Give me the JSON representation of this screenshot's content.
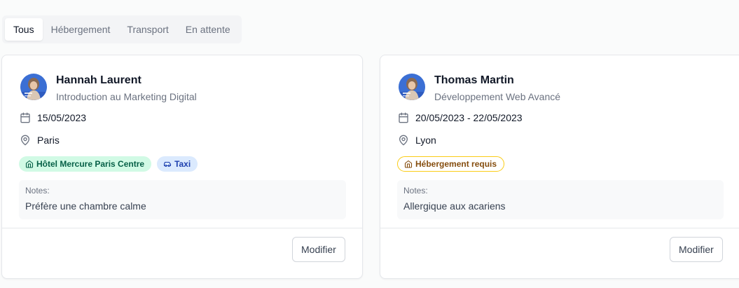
{
  "tabs": [
    {
      "label": "Tous",
      "active": true
    },
    {
      "label": "Hébergement",
      "active": false
    },
    {
      "label": "Transport",
      "active": false
    },
    {
      "label": "En attente",
      "active": false
    }
  ],
  "cards": [
    {
      "name": "Hannah Laurent",
      "course": "Introduction au Marketing Digital",
      "date": "15/05/2023",
      "location": "Paris",
      "badges": [
        {
          "label": "Hôtel Mercure Paris Centre",
          "icon": "home-icon",
          "color": "#065f46"
        },
        {
          "label": "Taxi",
          "icon": "car-icon",
          "color": "#1e40af"
        }
      ],
      "notes_label": "Notes:",
      "notes": "Préfère une chambre calme",
      "button": "Modifier"
    },
    {
      "name": "Thomas Martin",
      "course": "Développement Web Avancé",
      "date": "20/05/2023 - 22/05/2023",
      "location": "Lyon",
      "badges": [
        {
          "label": "Hébergement requis",
          "icon": "home-icon",
          "color": "#854d0e"
        }
      ],
      "notes_label": "Notes:",
      "notes": "Allergique aux acariens",
      "button": "Modifier"
    }
  ]
}
